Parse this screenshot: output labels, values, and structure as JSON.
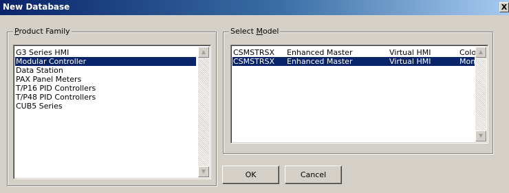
{
  "window": {
    "title": "New Database",
    "close_glyph": "X"
  },
  "product_family": {
    "legend_accel": "P",
    "legend_rest": "roduct Family",
    "items": [
      "G3 Series HMI",
      "Modular Controller",
      "Data Station",
      "PAX Panel Meters",
      "T/P16 PID Controllers",
      "T/P48 PID Controllers",
      "CUB5 Series"
    ],
    "selected_index": 1
  },
  "select_model": {
    "legend_prefix": "Select ",
    "legend_accel": "M",
    "legend_rest": "odel",
    "rows": [
      {
        "code": "CSMSTRSX",
        "name": "Enhanced Master",
        "target": "Virtual HMI",
        "variant": "Color"
      },
      {
        "code": "CSMSTRSX",
        "name": "Enhanced Master",
        "target": "Virtual HMI",
        "variant": "Mono"
      }
    ],
    "selected_index": 1
  },
  "buttons": {
    "ok": "OK",
    "cancel": "Cancel"
  },
  "icons": {
    "scroll_up": "scroll-up-arrow-icon",
    "scroll_down": "scroll-down-arrow-icon",
    "close": "close-icon"
  },
  "colors": {
    "selection": "#0a246a",
    "dialog_bg": "#d4d0c8",
    "titlebar_start": "#0a246a"
  }
}
